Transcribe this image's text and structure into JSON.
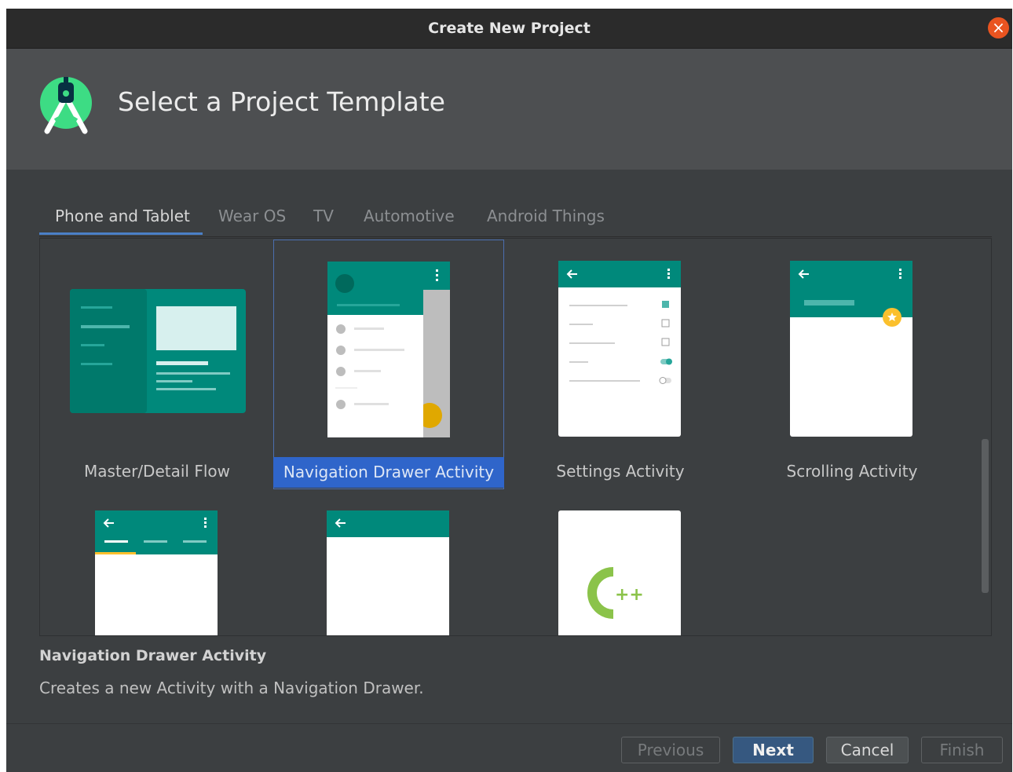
{
  "window": {
    "title": "Create New Project"
  },
  "header": {
    "title": "Select a Project Template"
  },
  "tabs": [
    {
      "label": "Phone and Tablet",
      "active": true
    },
    {
      "label": "Wear OS",
      "active": false
    },
    {
      "label": "TV",
      "active": false
    },
    {
      "label": "Automotive",
      "active": false
    },
    {
      "label": "Android Things",
      "active": false
    }
  ],
  "templates": [
    {
      "label": "Master/Detail Flow",
      "selected": false
    },
    {
      "label": "Navigation Drawer Activity",
      "selected": true
    },
    {
      "label": "Settings Activity",
      "selected": false
    },
    {
      "label": "Scrolling Activity",
      "selected": false
    },
    {
      "label": "",
      "selected": false
    },
    {
      "label": "",
      "selected": false
    },
    {
      "label": "",
      "selected": false
    }
  ],
  "description": {
    "title": "Navigation Drawer Activity",
    "text": "Creates a new Activity with a Navigation Drawer."
  },
  "buttons": {
    "previous": "Previous",
    "next": "Next",
    "cancel": "Cancel",
    "finish": "Finish"
  },
  "colors": {
    "accent": "#2f65ca",
    "teal": "#00897b",
    "amber": "#fbc02d",
    "close": "#e95420"
  }
}
